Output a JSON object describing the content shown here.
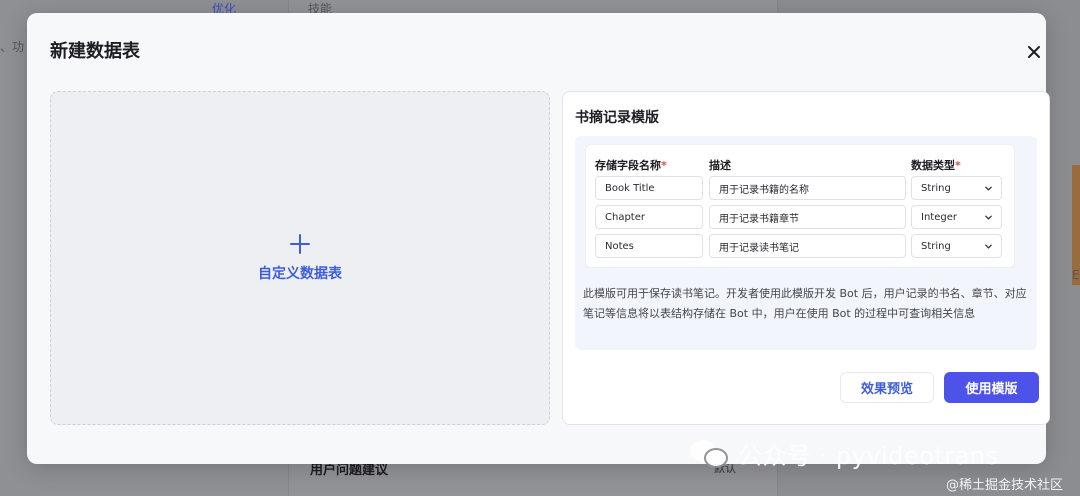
{
  "background": {
    "tag_label": "优化",
    "left_fragment": "、功",
    "center_fragment": "技能",
    "bottom_title": "用户问题建议",
    "bottom_right": "默认",
    "right_fragment": "E"
  },
  "watermark": {
    "main": "公众号 · pyvideotrans",
    "sub": "@稀土掘金技术社区"
  },
  "modal": {
    "title": "新建数据表",
    "close_icon": "close-icon",
    "custom": {
      "label": "自定义数据表",
      "icon": "plus-icon"
    },
    "template": {
      "title": "书摘记录模版",
      "columns": {
        "name": "存储字段名称",
        "desc": "描述",
        "type": "数据类型",
        "required_mark": "*"
      },
      "rows": [
        {
          "name": "Book Title",
          "desc": "用于记录书籍的名称",
          "type": "String"
        },
        {
          "name": "Chapter",
          "desc": "用于记录书籍章节",
          "type": "Integer"
        },
        {
          "name": "Notes",
          "desc": "用于记录读书笔记",
          "type": "String"
        }
      ],
      "description": "此模版可用于保存读书笔记。开发者使用此模版开发 Bot 后，用户记录的书名、章节、对应笔记等信息将以表结构存储在 Bot 中，用户在使用 Bot 的过程中可查询相关信息",
      "preview_button": "效果预览",
      "use_button": "使用模版"
    }
  },
  "colors": {
    "accent": "#4d53e8",
    "link_blue": "#3e5ddc",
    "required": "#e5484d"
  }
}
